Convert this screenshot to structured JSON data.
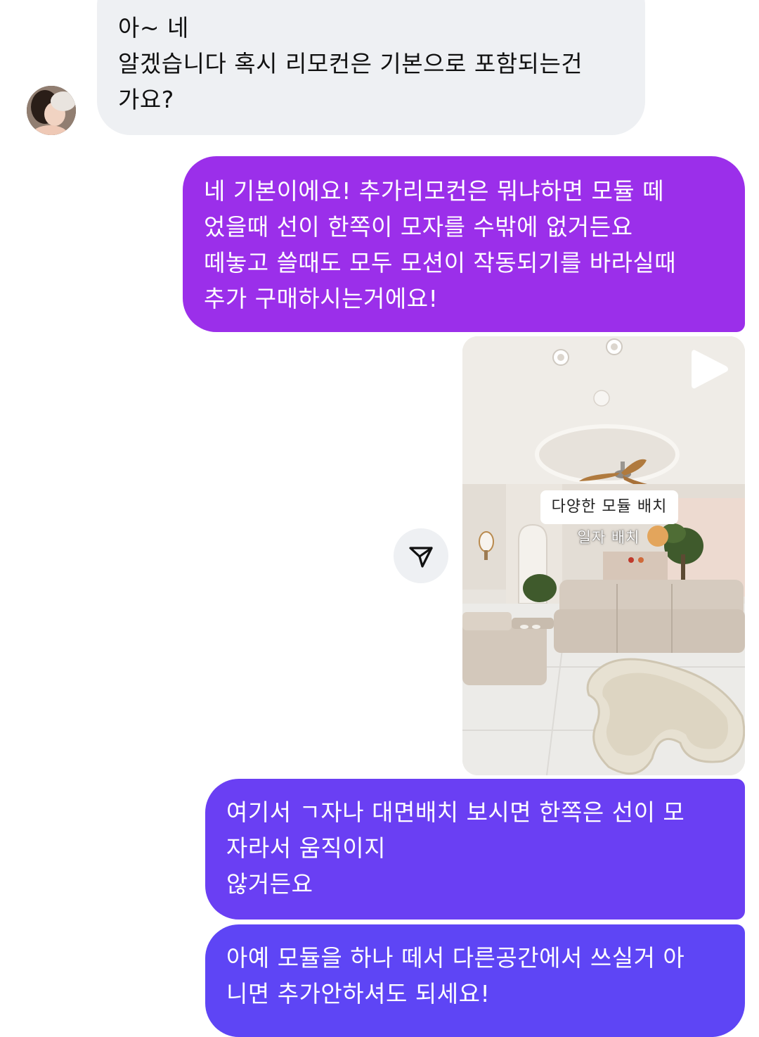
{
  "messages": {
    "incoming_1": {
      "text": "아~ 네\n알겠습니다 혹시 리모컨은 기본으로 포함되는건\n가요?"
    },
    "outgoing_1": {
      "text": "네 기본이에요! 추가리모컨은 뭐냐하면 모듈 떼\n었을때 선이 한쪽이 모자를 수밖에 없거든요\n떼놓고 쓸때도 모두 모션이 작동되기를 바라실때\n추가 구매하시는거에요!"
    },
    "reel": {
      "caption": "다양한 모듈 배치",
      "sub_caption": "일자 배치"
    },
    "outgoing_2": {
      "text": "여기서 ㄱ자나 대면배치 보시면 한쪽은 선이 모\n자라서 움직이지\n않거든요"
    },
    "outgoing_3": {
      "text": "아예 모듈을 하나 떼서 다른공간에서 쓰실거 아\n니면 추가안하셔도 되세요!"
    }
  },
  "icons": {
    "share": "send-icon",
    "play": "play-icon",
    "avatar": "profile-avatar"
  },
  "colors": {
    "incoming_bubble": "#eef0f3",
    "outgoing_bubble_1": "#9b2fea",
    "outgoing_bubble_2": "#6a3ff3",
    "outgoing_bubble_3": "#5e45f5"
  }
}
